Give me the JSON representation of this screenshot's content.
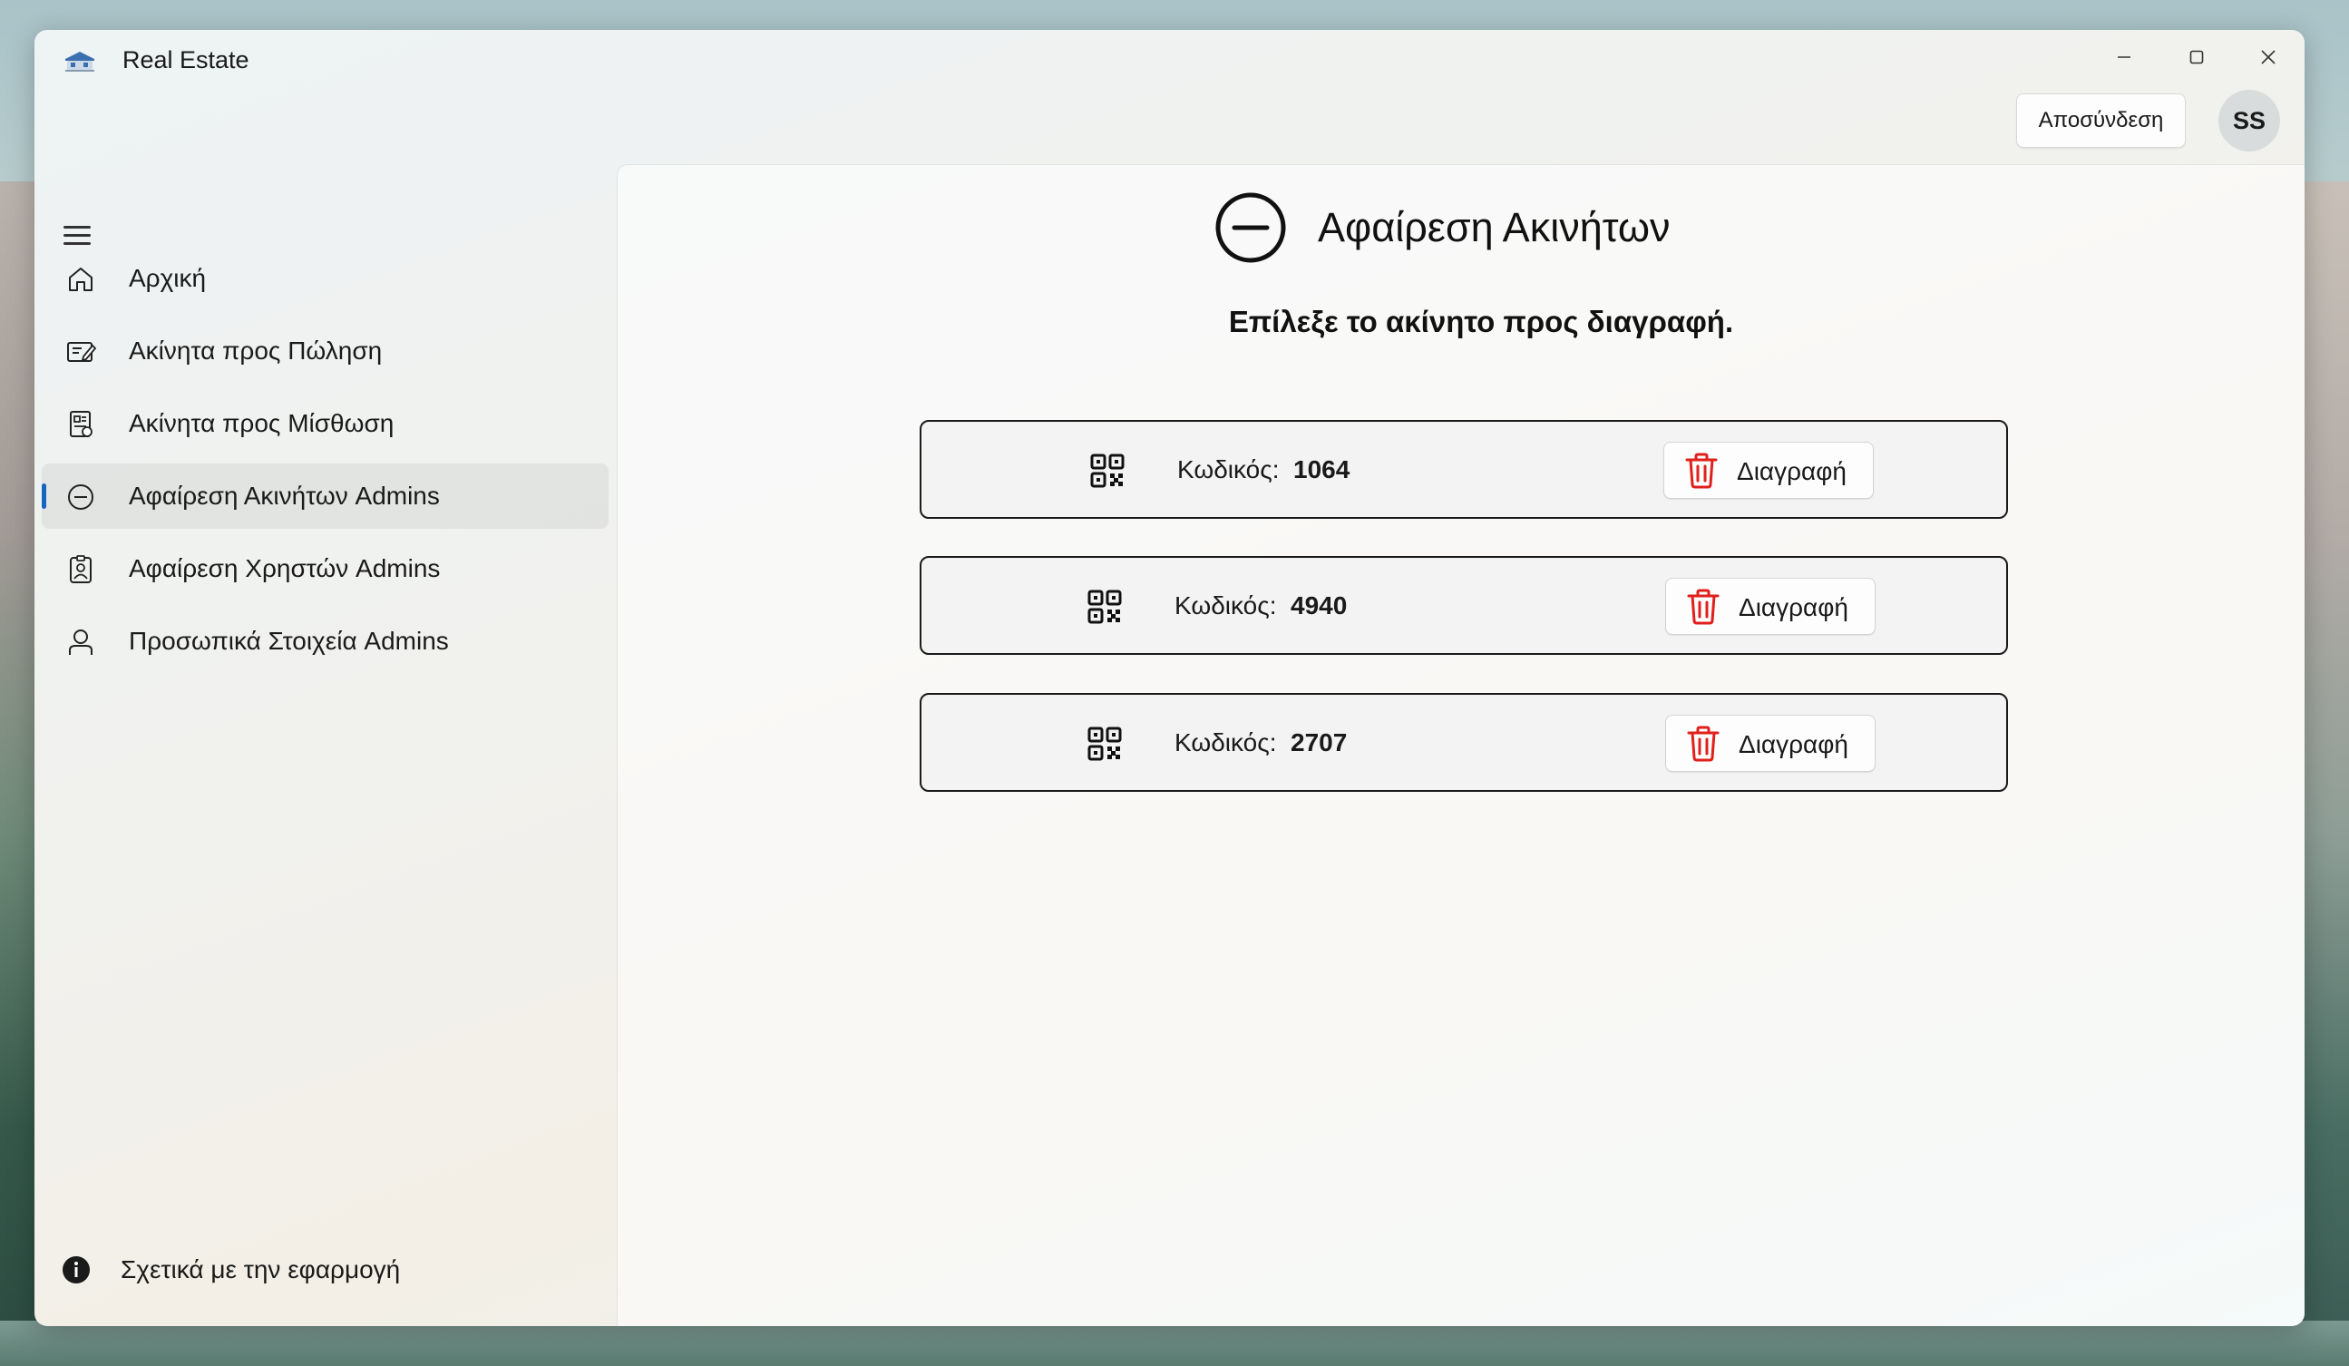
{
  "window": {
    "title": "Real Estate",
    "controls": {
      "minimize": "—",
      "maximize": "☐",
      "close": "✕"
    }
  },
  "header": {
    "logout_label": "Αποσύνδεση",
    "avatar_initials": "SS"
  },
  "sidebar": {
    "items": [
      {
        "label": "Αρχική",
        "icon": "home-icon",
        "active": false
      },
      {
        "label": "Ακίνητα προς Πώληση",
        "icon": "sale-listing-icon",
        "active": false
      },
      {
        "label": "Ακίνητα προς Μίσθωση",
        "icon": "rent-listing-icon",
        "active": false
      },
      {
        "label": "Αφαίρεση Ακινήτων Admins",
        "icon": "remove-circle-icon",
        "active": true
      },
      {
        "label": "Αφαίρεση Χρηστών Admins",
        "icon": "user-badge-icon",
        "active": false
      },
      {
        "label": "Προσωπικά Στοιχεία Admins",
        "icon": "person-icon",
        "active": false
      }
    ],
    "about_label": "Σχετικά με την εφαρμογή"
  },
  "main": {
    "title": "Αφαίρεση Ακινήτων",
    "subtitle": "Επίλεξε το ακίνητο προς διαγραφή.",
    "code_label": "Κωδικός:",
    "delete_label": "Διαγραφή",
    "properties": [
      {
        "code": "1064"
      },
      {
        "code": "4940"
      },
      {
        "code": "2707"
      }
    ]
  },
  "colors": {
    "accent": "#1565c0",
    "delete_icon": "#e0201b"
  }
}
